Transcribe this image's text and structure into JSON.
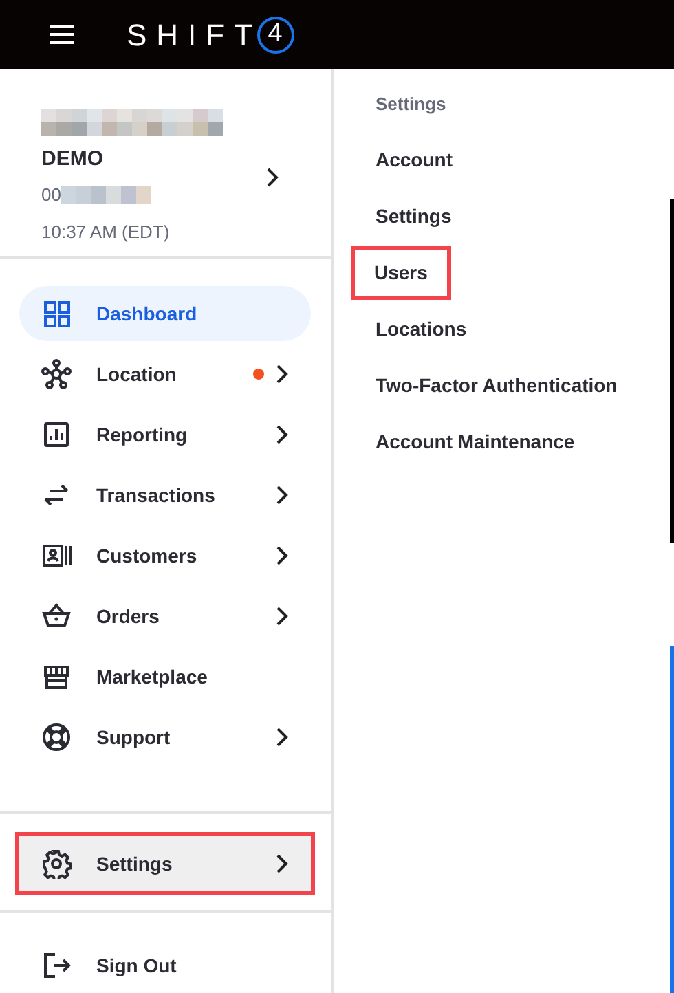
{
  "header": {
    "logo_text": "SHIFT",
    "logo_badge": "4"
  },
  "account": {
    "name": "DEMO",
    "id": "00",
    "time": "10:37 AM (EDT)"
  },
  "nav": [
    {
      "label": "Dashboard",
      "selected": true,
      "chevron": false,
      "highlighted": false
    },
    {
      "label": "Location",
      "selected": false,
      "chevron": true,
      "color": "#f4511e",
      "highlighted": false
    },
    {
      "label": "Reporting",
      "selected": false,
      "chevron": true,
      "highlighted": false
    },
    {
      "label": "Transactions",
      "selected": false,
      "chevron": true,
      "highlighted": false
    },
    {
      "label": "Customers",
      "selected": false,
      "chevron": true,
      "highlighted": false
    },
    {
      "label": "Orders",
      "selected": false,
      "chevron": true,
      "highlighted": false
    },
    {
      "label": "Marketplace",
      "selected": false,
      "chevron": false,
      "highlighted": false
    },
    {
      "label": "Support",
      "selected": false,
      "chevron": true,
      "highlighted": false
    }
  ],
  "settings_item": {
    "label": "Settings",
    "expanded": true,
    "highlighted": true
  },
  "sign_out": {
    "label": "Sign Out"
  },
  "submenu": {
    "title": "Settings",
    "items": [
      {
        "label": "Account",
        "highlighted": false
      },
      {
        "label": "Settings",
        "highlighted": false
      },
      {
        "label": "Users",
        "highlighted": true
      },
      {
        "label": "Locations",
        "highlighted": false
      },
      {
        "label": "Two-Factor Authentication",
        "highlighted": false
      },
      {
        "label": "Account Maintenance",
        "highlighted": false
      }
    ]
  }
}
